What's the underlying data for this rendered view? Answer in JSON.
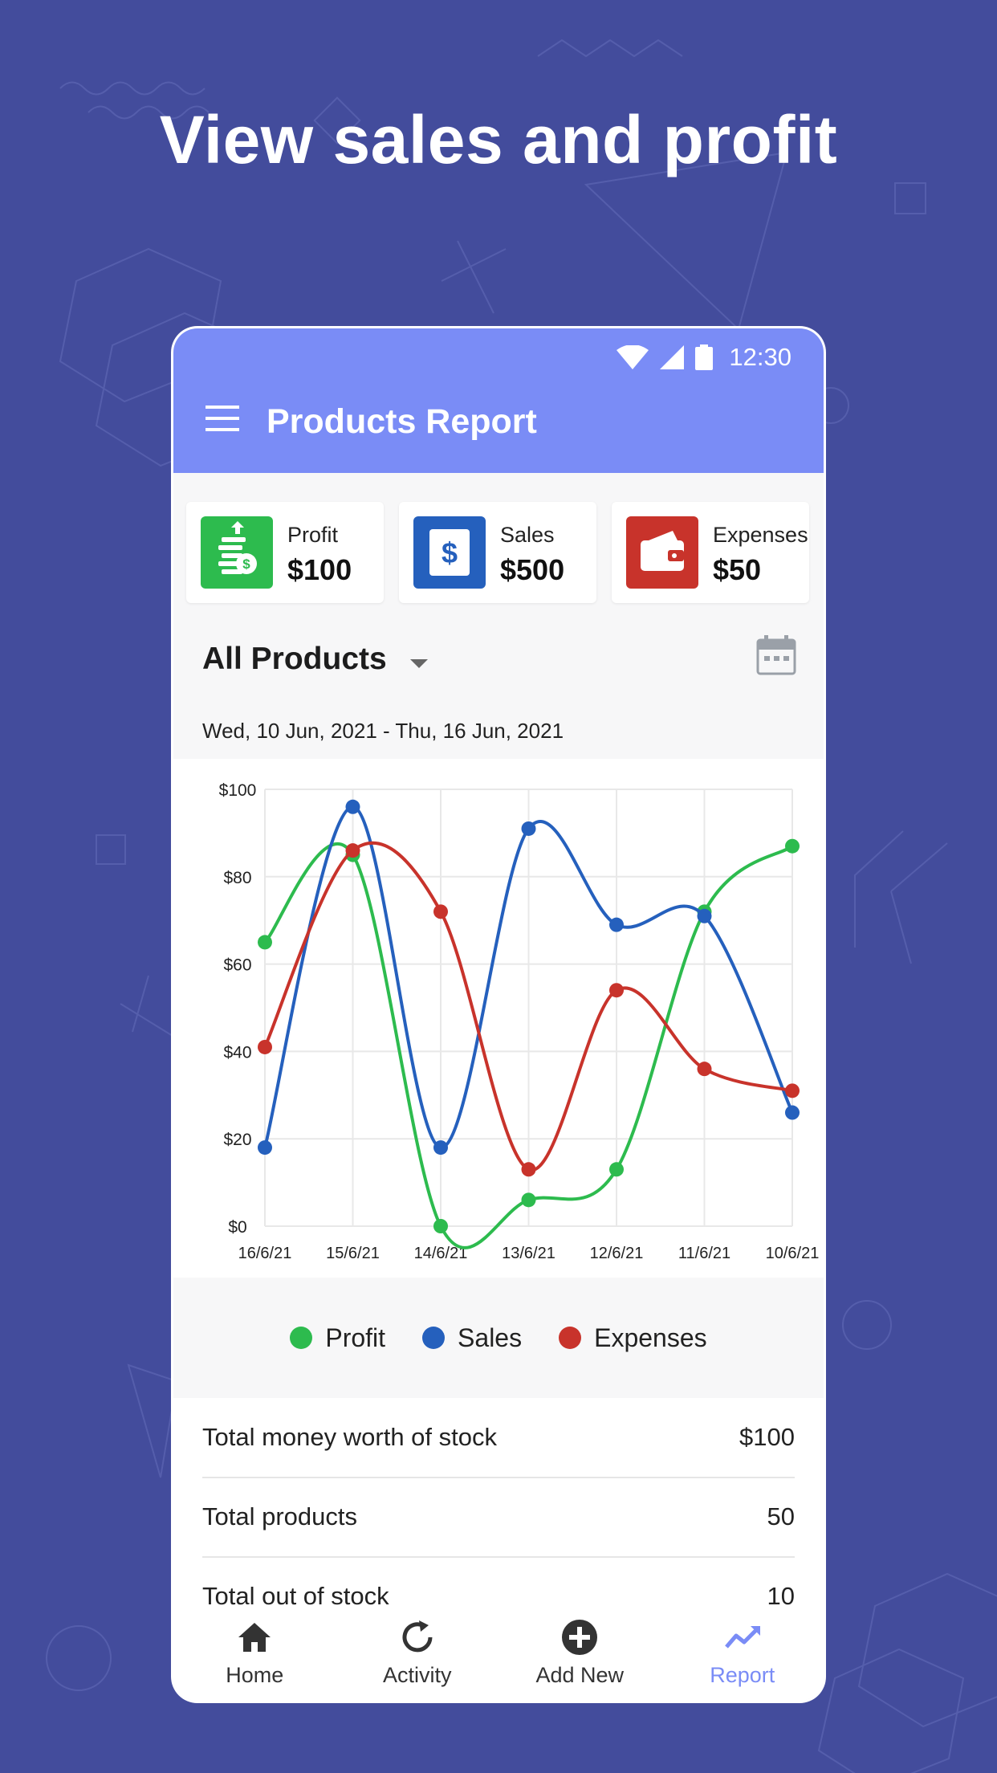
{
  "headline": "View sales and profit",
  "status_bar": {
    "time": "12:30"
  },
  "app_bar": {
    "title": "Products Report"
  },
  "summary_cards": [
    {
      "label": "Profit",
      "value": "$100",
      "color": "#2dbb4e",
      "icon": "profit-coins-icon"
    },
    {
      "label": "Sales",
      "value": "$500",
      "color": "#2560bd",
      "icon": "dollar-document-icon"
    },
    {
      "label": "Expenses",
      "value": "$50",
      "color": "#c8332b",
      "icon": "wallet-icon"
    }
  ],
  "filter": {
    "title": "All Products",
    "date_range": "Wed, 10 Jun, 2021 - Thu, 16 Jun, 2021"
  },
  "chart_data": {
    "type": "line",
    "x": [
      "16/6/21",
      "15/6/21",
      "14/6/21",
      "13/6/21",
      "12/6/21",
      "11/6/21",
      "10/6/21"
    ],
    "y_ticks": [
      "$0",
      "$20",
      "$40",
      "$60",
      "$80",
      "$100"
    ],
    "ylim": [
      0,
      100
    ],
    "grid": true,
    "series": [
      {
        "name": "Profit",
        "color": "#2dbb4e",
        "values": [
          65,
          85,
          0,
          6,
          13,
          72,
          87
        ]
      },
      {
        "name": "Sales",
        "color": "#2560bd",
        "values": [
          18,
          96,
          18,
          91,
          69,
          71,
          26
        ]
      },
      {
        "name": "Expenses",
        "color": "#c8332b",
        "values": [
          41,
          86,
          72,
          13,
          54,
          36,
          31
        ]
      }
    ]
  },
  "legend": [
    "Profit",
    "Sales",
    "Expenses"
  ],
  "summary_rows": [
    {
      "label": "Total money worth of stock",
      "value": "$100"
    },
    {
      "label": "Total products",
      "value": "50"
    },
    {
      "label": "Total out of stock",
      "value": "10"
    }
  ],
  "bottom_nav": [
    {
      "label": "Home",
      "icon": "home-icon",
      "active": false
    },
    {
      "label": "Activity",
      "icon": "activity-icon",
      "active": false
    },
    {
      "label": "Add New",
      "icon": "add-circle-icon",
      "active": false
    },
    {
      "label": "Report",
      "icon": "trend-chart-icon",
      "active": true
    }
  ],
  "colors": {
    "background": "#434c9c",
    "app_bar": "#7a8cf6",
    "accent": "#7a8cf6"
  }
}
